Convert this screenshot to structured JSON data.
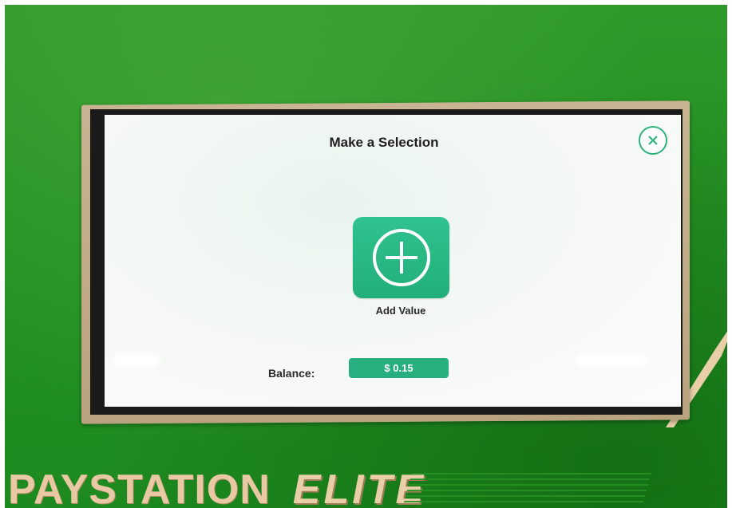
{
  "screen": {
    "title": "Make a Selection",
    "close_icon": "close-icon",
    "add_value": {
      "icon": "plus-circle-icon",
      "label": "Add Value"
    },
    "balance": {
      "label": "Balance:",
      "value": "$ 0.15"
    }
  },
  "brand": {
    "name": "PAYSTATION",
    "tagline": "ELITE"
  },
  "colors": {
    "kiosk_green": "#259224",
    "accent_green": "#27b07d",
    "bezel": "#c8b492",
    "brand_text": "#e8c9a3"
  }
}
